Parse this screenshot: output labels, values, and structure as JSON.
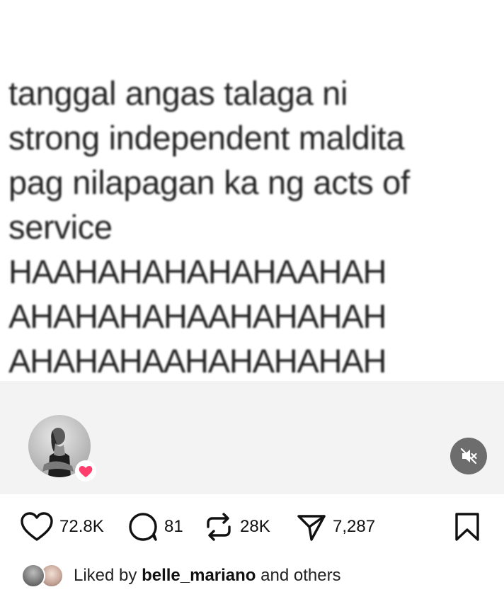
{
  "post": {
    "text_lines": [
      "tanggal angas talaga ni",
      "strong independent maldita",
      "pag nilapagan ka ng acts of",
      "service",
      "HAAHAHAHAHAHAAHAH",
      "AHAHAHAHAAHAHAHAH",
      "AHAHAHAAHAHAHAHAH"
    ]
  },
  "actions": {
    "likes": "72.8K",
    "comments": "81",
    "reposts": "28K",
    "shares": "7,287"
  },
  "liked_by": {
    "prefix": "Liked by",
    "user": "belle_mariano",
    "suffix": "and others"
  },
  "icons": {
    "like": "heart-outline-icon",
    "comment": "comment-bubble-icon",
    "repost": "repost-arrows-icon",
    "share": "paper-plane-icon",
    "save": "bookmark-icon",
    "mute": "speaker-muted-icon",
    "reaction": "heart-filled-icon"
  },
  "colors": {
    "text": "#222222",
    "heart_badge": "#ff3e6c",
    "mute_button": "#6d6d6d",
    "media_footer": "#f3f3f3"
  }
}
